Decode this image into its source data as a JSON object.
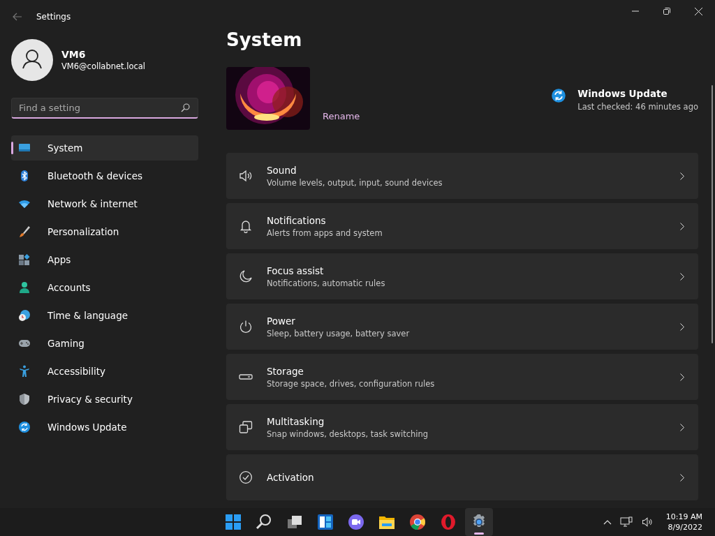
{
  "window": {
    "title": "Settings"
  },
  "account": {
    "name": "VM6",
    "email": "VM6@collabnet.local"
  },
  "search": {
    "placeholder": "Find a setting"
  },
  "sidebar": {
    "items": [
      {
        "label": "System",
        "selected": true
      },
      {
        "label": "Bluetooth & devices",
        "selected": false
      },
      {
        "label": "Network & internet",
        "selected": false
      },
      {
        "label": "Personalization",
        "selected": false
      },
      {
        "label": "Apps",
        "selected": false
      },
      {
        "label": "Accounts",
        "selected": false
      },
      {
        "label": "Time & language",
        "selected": false
      },
      {
        "label": "Gaming",
        "selected": false
      },
      {
        "label": "Accessibility",
        "selected": false
      },
      {
        "label": "Privacy & security",
        "selected": false
      },
      {
        "label": "Windows Update",
        "selected": false
      }
    ]
  },
  "page": {
    "title": "System",
    "device": {
      "rename": "Rename"
    },
    "update": {
      "title": "Windows Update",
      "status": "Last checked: 46 minutes ago"
    },
    "settings": [
      {
        "title": "Sound",
        "description": "Volume levels, output, input, sound devices"
      },
      {
        "title": "Notifications",
        "description": "Alerts from apps and system"
      },
      {
        "title": "Focus assist",
        "description": "Notifications, automatic rules"
      },
      {
        "title": "Power",
        "description": "Sleep, battery usage, battery saver"
      },
      {
        "title": "Storage",
        "description": "Storage space, drives, configuration rules"
      },
      {
        "title": "Multitasking",
        "description": "Snap windows, desktops, task switching"
      },
      {
        "title": "Activation"
      }
    ]
  },
  "taskbar": {
    "apps": [
      {
        "active": false
      },
      {
        "active": false
      },
      {
        "active": false
      },
      {
        "active": false
      },
      {
        "active": false
      },
      {
        "active": false
      },
      {
        "active": false
      },
      {
        "active": false
      },
      {
        "active": true
      }
    ],
    "time": "10:19 AM",
    "date": "8/9/2022"
  }
}
